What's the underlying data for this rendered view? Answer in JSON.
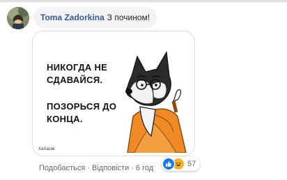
{
  "comment": {
    "author": "Toma Zadorkina",
    "text": "З почином!"
  },
  "sticker": {
    "lines": [
      "НИКОГДА НЕ",
      "СДАВАЙСЯ.",
      "ПОЗОРЬСЯ ДО",
      "КОНЦА."
    ],
    "watermark": "ХаХасик"
  },
  "actions": {
    "like_label": "Подобається",
    "reply_label": "Відповісти",
    "separator": "·",
    "time": "6 год"
  },
  "reactions": {
    "icons": [
      "like-icon",
      "haha-icon"
    ],
    "count": "57"
  },
  "colors": {
    "author": "#385898",
    "bubble": "#f2f3f5",
    "like": "#1877f2",
    "haha": "#f7b125",
    "robe": "#f08a24"
  }
}
